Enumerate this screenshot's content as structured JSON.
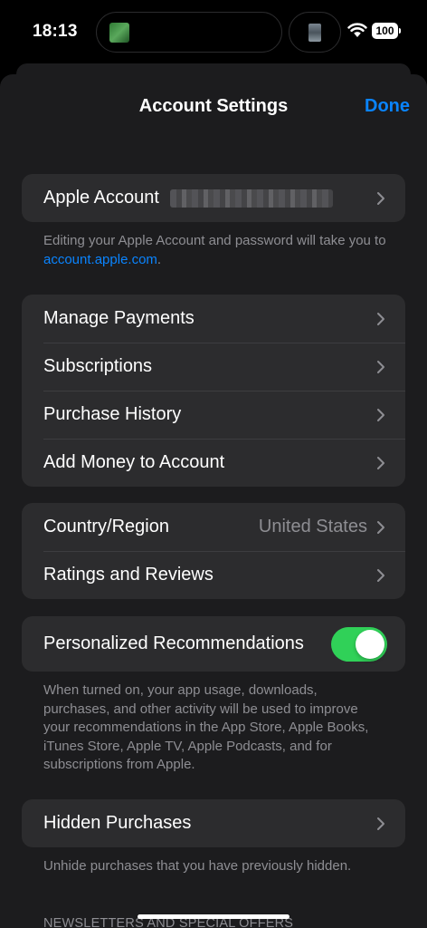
{
  "status_bar": {
    "time": "18:13",
    "battery": "100"
  },
  "header": {
    "title": "Account Settings",
    "done_label": "Done"
  },
  "apple_account": {
    "label": "Apple Account",
    "note_text": "Editing your Apple Account and password will take you to ",
    "note_link": "account.apple.com",
    "note_end": "."
  },
  "payments_group": {
    "items": [
      {
        "label": "Manage Payments"
      },
      {
        "label": "Subscriptions"
      },
      {
        "label": "Purchase History"
      },
      {
        "label": "Add Money to Account"
      }
    ]
  },
  "region_group": {
    "country_label": "Country/Region",
    "country_value": "United States",
    "ratings_label": "Ratings and Reviews"
  },
  "recommendations": {
    "label": "Personalized Recommendations",
    "enabled": true,
    "note": "When turned on, your app usage, downloads, purchases, and other activity will be used to improve your recommendations in the App Store, Apple Books, iTunes Store, Apple TV, Apple Podcasts, and for subscriptions from Apple."
  },
  "hidden_purchases": {
    "label": "Hidden Purchases",
    "note": "Unhide purchases that you have previously hidden."
  },
  "newsletters_header": "NEWSLETTERS AND SPECIAL OFFERS",
  "colors": {
    "accent": "#0a84ff",
    "toggle_on": "#30d158",
    "cell_background": "#2c2c2e",
    "sheet_background": "#1c1c1e"
  }
}
